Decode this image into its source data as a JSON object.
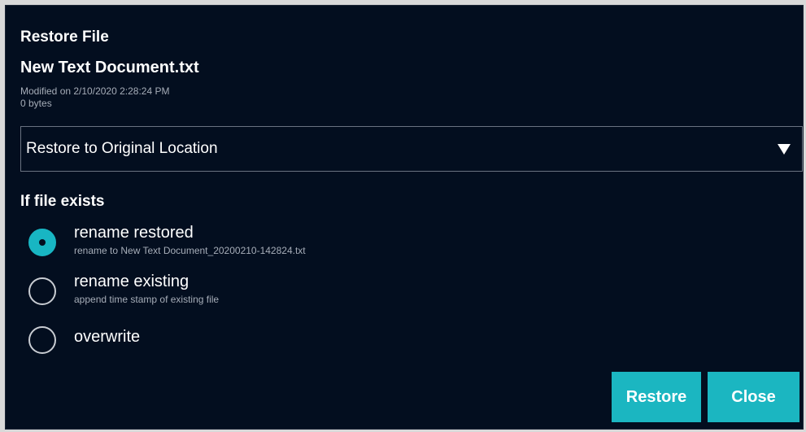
{
  "dialog": {
    "title": "Restore File",
    "file_name": "New Text Document.txt",
    "modified": "Modified on 2/10/2020 2:28:24 PM",
    "size": "0 bytes"
  },
  "restore_location": {
    "selected": "Restore to Original Location"
  },
  "if_file_exists": {
    "label": "If file exists",
    "options": [
      {
        "label": "rename restored",
        "description": "rename to New Text Document_20200210-142824.txt",
        "checked": true
      },
      {
        "label": "rename existing",
        "description": "append time stamp of existing file",
        "checked": false
      },
      {
        "label": "overwrite",
        "description": "",
        "checked": false
      }
    ]
  },
  "buttons": {
    "restore": "Restore",
    "close": "Close"
  },
  "colors": {
    "background": "#030e1f",
    "accent": "#1bb6c1"
  }
}
